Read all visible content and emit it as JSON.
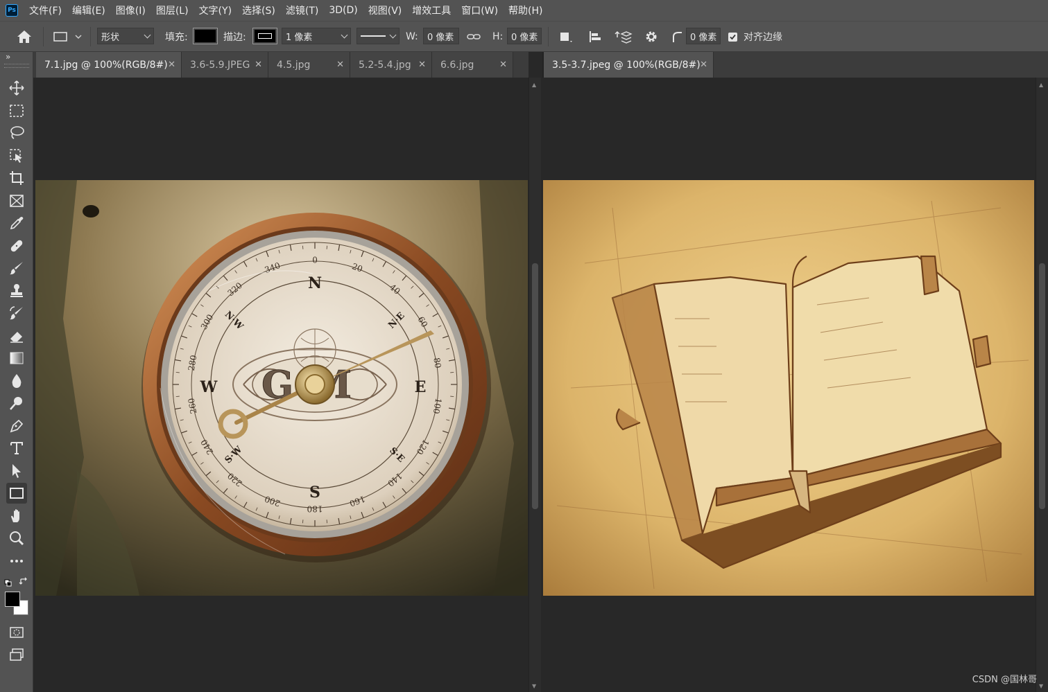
{
  "app": {
    "logo": "Ps"
  },
  "menu": [
    "文件(F)",
    "编辑(E)",
    "图像(I)",
    "图层(L)",
    "文字(Y)",
    "选择(S)",
    "滤镜(T)",
    "3D(D)",
    "视图(V)",
    "增效工具",
    "窗口(W)",
    "帮助(H)"
  ],
  "options": {
    "mode": "形状",
    "fill_label": "填充:",
    "fill_color": "#000000",
    "stroke_label": "描边:",
    "stroke_width": "1 像素",
    "w_label": "W:",
    "w_value": "0 像素",
    "h_label": "H:",
    "h_value": "0 像素",
    "radius_value": "0 像素",
    "align_edges_label": "对齐边缘",
    "align_edges_checked": true
  },
  "toolbar": {
    "collapse": "»",
    "tools": [
      "move-icon",
      "marquee-icon",
      "lasso-icon",
      "object-select-icon",
      "crop-icon",
      "frame-icon",
      "eyedropper-icon",
      "healing-icon",
      "brush-icon",
      "stamp-icon",
      "history-brush-icon",
      "eraser-icon",
      "gradient-icon",
      "blur-icon",
      "dodge-icon",
      "pen-icon",
      "type-icon",
      "path-select-icon",
      "rectangle-icon",
      "hand-icon",
      "zoom-icon",
      "more-tools-icon"
    ],
    "active_tool": "rectangle-icon",
    "foreground_color": "#000000",
    "background_color": "#ffffff"
  },
  "left_doc": {
    "tabs": [
      "7.1.jpg @ 100%(RGB/8#)",
      "3.6-5.9.JPEG",
      "4.5.jpg",
      "5.2-5.4.jpg",
      "6.6.jpg"
    ],
    "active_tab": 0,
    "compass": {
      "cardinals": [
        "N",
        "E",
        "S",
        "W"
      ],
      "intercardinals": [
        "N·E",
        "S·E",
        "S·W",
        "N·W"
      ],
      "degrees": [
        "0",
        "20",
        "40",
        "60",
        "80",
        "100",
        "120",
        "140",
        "160",
        "180",
        "200",
        "220",
        "240",
        "260",
        "280",
        "300",
        "320",
        "340"
      ],
      "monogram": "GM"
    }
  },
  "right_doc": {
    "tabs": [
      "3.5-3.7.jpeg @ 100%(RGB/8#)"
    ],
    "active_tab": 0
  },
  "watermark": "CSDN @国林哥"
}
